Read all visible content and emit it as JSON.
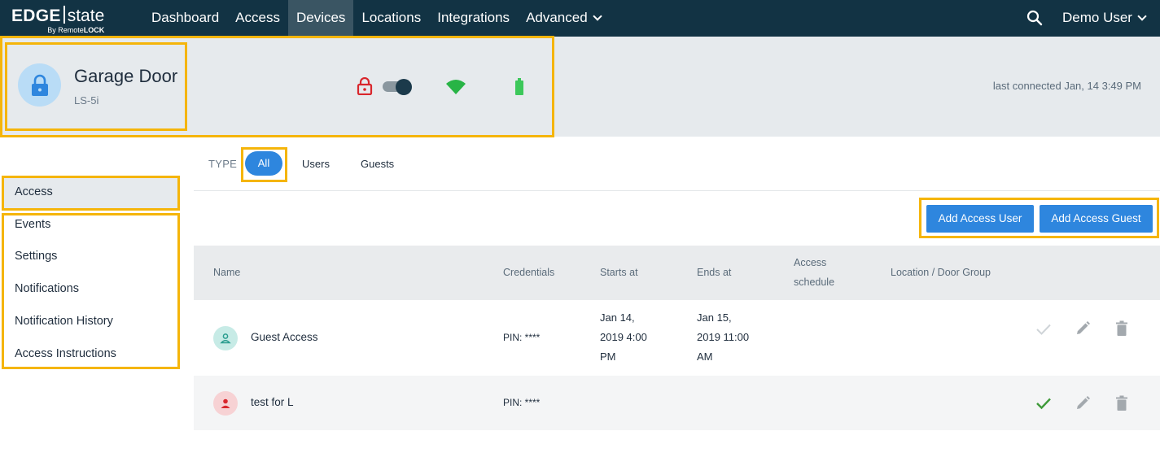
{
  "logo": {
    "main_left": "EDGE",
    "main_right": "state",
    "sub_prefix": "By Remote",
    "sub_brand": "LOCK"
  },
  "nav": {
    "items": [
      {
        "label": "Dashboard"
      },
      {
        "label": "Access"
      },
      {
        "label": "Devices",
        "active": true
      },
      {
        "label": "Locations"
      },
      {
        "label": "Integrations"
      },
      {
        "label": "Advanced",
        "dropdown": true
      }
    ],
    "user": "Demo User",
    "search_icon": "search-icon"
  },
  "device": {
    "name": "Garage Door",
    "model": "LS-5i",
    "lock_state": "unlocked",
    "status_icons": [
      "unlocked-padlock-icon",
      "lock-toggle",
      "wifi-icon",
      "battery-icon"
    ],
    "last_connected": "last connected Jan, 14 3:49 PM"
  },
  "sidebar": {
    "items": [
      {
        "label": "Access",
        "active": true
      },
      {
        "label": "Events"
      },
      {
        "label": "Settings"
      },
      {
        "label": "Notifications"
      },
      {
        "label": "Notification History"
      },
      {
        "label": "Access Instructions"
      }
    ]
  },
  "filter": {
    "type_label": "TYPE",
    "options": [
      {
        "label": "All",
        "selected": true
      },
      {
        "label": "Users"
      },
      {
        "label": "Guests"
      }
    ]
  },
  "actions": {
    "add_user": "Add Access User",
    "add_guest": "Add Access Guest"
  },
  "table": {
    "headers": {
      "name": "Name",
      "credentials": "Credentials",
      "starts": "Starts at",
      "ends": "Ends at",
      "schedule_1": "Access",
      "schedule_2": "schedule",
      "location": "Location / Door Group"
    },
    "rows": [
      {
        "name": "Guest Access",
        "kind": "guest",
        "credentials": "PIN: ****",
        "starts": [
          "Jan 14,",
          "2019 4:00",
          "PM"
        ],
        "ends": [
          "Jan 15,",
          "2019 11:00",
          "AM"
        ],
        "synced": false
      },
      {
        "name": "test for L",
        "kind": "user",
        "credentials": "PIN: ****",
        "starts": [],
        "ends": [],
        "synced": true
      }
    ]
  },
  "colors": {
    "nav_bg": "#123344",
    "accent": "#2e86de",
    "highlight": "#f5b50a",
    "guest_avatar": "#c7ebe6",
    "user_avatar": "#f7d2d4",
    "synced_check": "#3f9a3a",
    "unlocked_red": "#d9262c",
    "wifi_green": "#28b446",
    "battery_green": "#3cc85a"
  }
}
